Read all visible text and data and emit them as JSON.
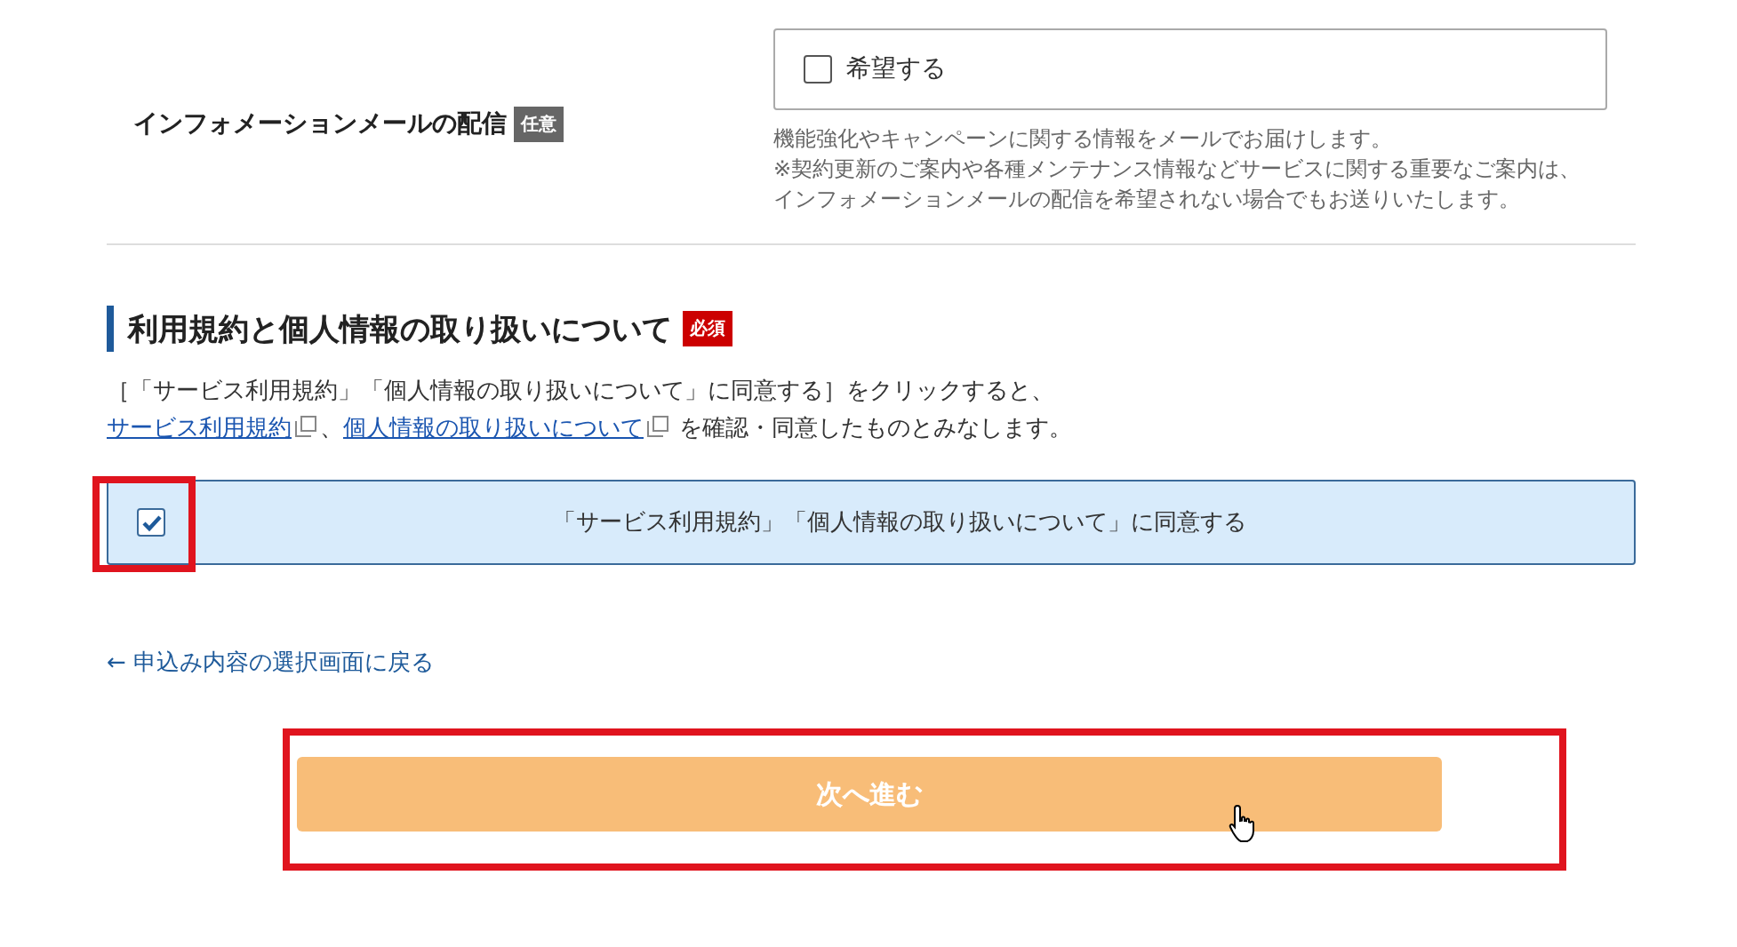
{
  "newsletter": {
    "label": "インフォメーションメールの配信",
    "badge": "任意",
    "option": {
      "label": "希望する",
      "checked": false
    },
    "notes": [
      "機能強化やキャンペーンに関する情報をメールでお届けします。",
      "※契約更新のご案内や各種メンテナンス情報などサービスに関する重要なご案内は、",
      "インフォメーションメールの配信を希望されない場合でもお送りいたします。"
    ]
  },
  "terms": {
    "heading": "利用規約と個人情報の取り扱いについて",
    "badge": "必須",
    "intro": "［「サービス利用規約」「個人情報の取り扱いについて」に同意する］をクリックすると、",
    "links": [
      "サービス利用規約",
      "個人情報の取り扱いについて"
    ],
    "separator": "、",
    "outro": "を確認・同意したものとみなします。",
    "agree": {
      "label": "「サービス利用規約」「個人情報の取り扱いについて」に同意する",
      "checked": true
    }
  },
  "back_link": "← 申込み内容の選択画面に戻る",
  "next_button": {
    "label": "次へ進む",
    "disabled": true
  }
}
